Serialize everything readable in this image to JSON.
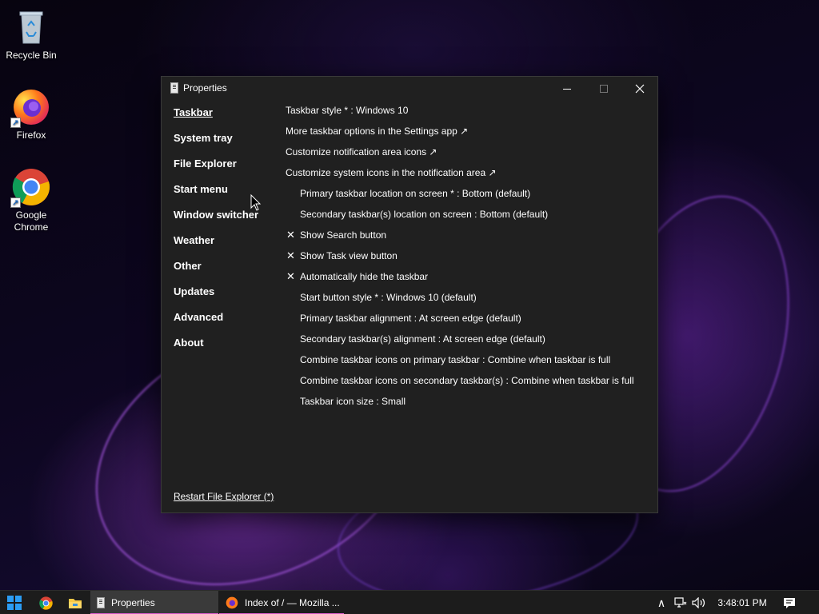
{
  "desktop": {
    "icons": [
      {
        "label": "Recycle Bin"
      },
      {
        "label": "Firefox"
      },
      {
        "label": "Google Chrome"
      }
    ]
  },
  "window": {
    "title": "Properties",
    "nav": [
      {
        "label": "Taskbar"
      },
      {
        "label": "System tray"
      },
      {
        "label": "File Explorer"
      },
      {
        "label": "Start menu"
      },
      {
        "label": "Window switcher"
      },
      {
        "label": "Weather"
      },
      {
        "label": "Other"
      },
      {
        "label": "Updates"
      },
      {
        "label": "Advanced"
      },
      {
        "label": "About"
      }
    ],
    "settings": [
      {
        "label": "Taskbar style * : Windows 10"
      },
      {
        "label": "More taskbar options in the Settings app ↗"
      },
      {
        "label": "Customize notification area icons ↗"
      },
      {
        "label": "Customize system icons in the notification area ↗"
      },
      {
        "label": "Primary taskbar location on screen * : Bottom (default)"
      },
      {
        "label": "Secondary taskbar(s) location on screen : Bottom (default)"
      },
      {
        "label": "Show Search button",
        "check": "✕"
      },
      {
        "label": "Show Task view button",
        "check": "✕"
      },
      {
        "label": "Automatically hide the taskbar",
        "check": "✕"
      },
      {
        "label": "Start button style * : Windows 10 (default)"
      },
      {
        "label": "Primary taskbar alignment : At screen edge (default)"
      },
      {
        "label": "Secondary taskbar(s) alignment : At screen edge (default)"
      },
      {
        "label": "Combine taskbar icons on primary taskbar : Combine when taskbar is full"
      },
      {
        "label": "Combine taskbar icons on secondary taskbar(s) : Combine when taskbar is full"
      },
      {
        "label": "Taskbar icon size : Small"
      }
    ],
    "restart_link": "Restart File Explorer (*)"
  },
  "taskbar": {
    "apps": [
      {
        "label": "Properties"
      },
      {
        "label": "Index of / — Mozilla ..."
      }
    ],
    "clock": "3:48:01 PM",
    "tray_chevron": "∧"
  },
  "colors": {
    "accent": "#d85ac8",
    "window_bg": "#202020",
    "taskbar_bg": "#1c1c1c",
    "start_blue": "#2b9cf2"
  }
}
